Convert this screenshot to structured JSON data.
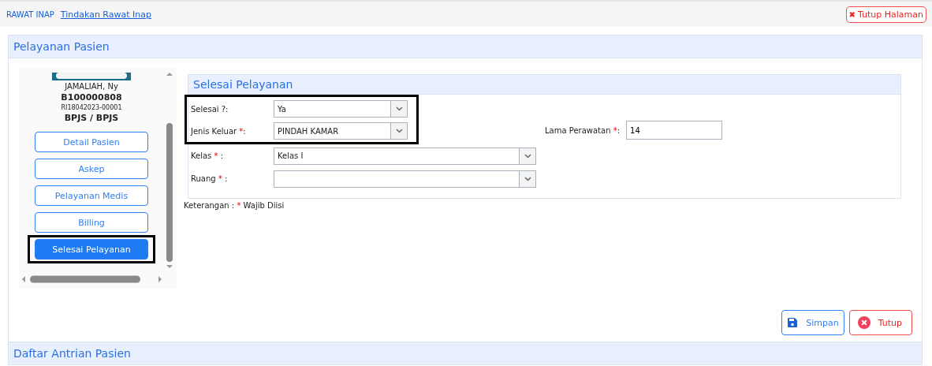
{
  "breadcrumb": {
    "section": "RAWAT INAP",
    "link": "Tindakan Rawat Inap"
  },
  "close_page_button": {
    "icon": "✖",
    "label": "Tutup Halaman"
  },
  "panel": {
    "title": "Pelayanan Pasien"
  },
  "patient": {
    "name": "JAMALIAH, Ny",
    "record_no": "B100000808",
    "visit_no": "RI18042023-00001",
    "payer": "BPJS / BPJS"
  },
  "menu": [
    {
      "label": "Detail Pasien",
      "selected": false,
      "highlighted": false
    },
    {
      "label": "Askep",
      "selected": false,
      "highlighted": false
    },
    {
      "label": "Pelayanan Medis",
      "selected": false,
      "highlighted": false
    },
    {
      "label": "Billing",
      "selected": false,
      "highlighted": false
    },
    {
      "label": "Selesai Pelayanan",
      "selected": true,
      "highlighted": true
    }
  ],
  "form": {
    "title": "Selesai Pelayanan",
    "fields": [
      {
        "label": "Selesai ?:",
        "required": false,
        "value": "Ya",
        "highlighted": true
      },
      {
        "label": "Jenis Keluar ",
        "required": true,
        "suffix": ":",
        "value": "PINDAH KAMAR",
        "highlighted": true
      },
      {
        "label": "Kelas ",
        "required": true,
        "suffix": " :",
        "value": "Kelas I",
        "highlighted": false
      },
      {
        "label": "Ruang ",
        "required": true,
        "suffix": " :",
        "highlighted": false
      }
    ],
    "side_field": {
      "label": "Lama Perawatan ",
      "required": true,
      "suffix": ":",
      "value": "14"
    },
    "note": {
      "label": "Keterangan : ",
      "mark": "*",
      "text": " Wajib Diisi"
    }
  },
  "buttons": [
    {
      "kind": "save",
      "label": "Simpan"
    },
    {
      "kind": "close",
      "label": "Tutup"
    }
  ],
  "next_panel": {
    "title": "Daftar Antrian Pasien"
  }
}
